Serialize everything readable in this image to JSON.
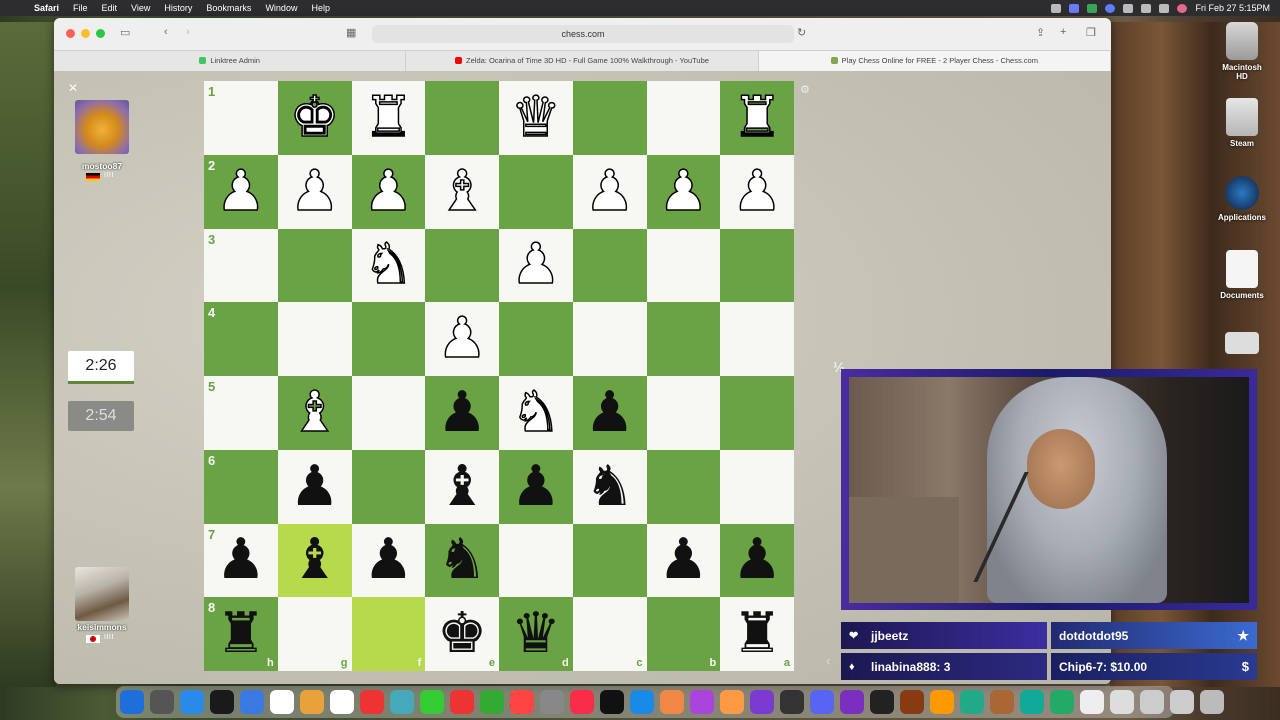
{
  "menubar": {
    "app": "Safari",
    "items": [
      "File",
      "Edit",
      "View",
      "History",
      "Bookmarks",
      "Window",
      "Help"
    ],
    "clock": "Fri Feb 27  5:15PM"
  },
  "browser": {
    "url": "chess.com",
    "tabs": [
      {
        "label": "Linktree Admin",
        "color": "#43c463"
      },
      {
        "label": "Zelda: Ocarina of Time 3D HD - Full Game 100% Walkthrough - YouTube",
        "color": "#ff0000"
      },
      {
        "label": "Play Chess Online for FREE - 2 Player Chess - Chess.com",
        "color": "#7fa650"
      }
    ]
  },
  "game": {
    "top_player": {
      "name": "mostoo87",
      "country": "de",
      "bars": "IIII"
    },
    "bottom_player": {
      "name": "keisimmons",
      "country": "jp",
      "bars": "IIII"
    },
    "clock_active": "2:26",
    "clock_inactive": "2:54",
    "draw_offer_label": "½",
    "ranks": [
      "1",
      "2",
      "3",
      "4",
      "5",
      "6",
      "7",
      "8"
    ],
    "files": [
      "h",
      "g",
      "f",
      "e",
      "d",
      "c",
      "b",
      "a"
    ],
    "board": [
      [
        "",
        "K",
        "R",
        "",
        "Q",
        "",
        "",
        "R"
      ],
      [
        "P",
        "P",
        "P",
        "B",
        "",
        "P",
        "P",
        "P"
      ],
      [
        "",
        "",
        "N",
        "",
        "P",
        "",
        "",
        ""
      ],
      [
        "",
        "",
        "",
        "P",
        "",
        "",
        "",
        ""
      ],
      [
        "",
        "B",
        "",
        "p",
        "N",
        "p",
        "",
        ""
      ],
      [
        "",
        "p",
        "",
        "b",
        "p",
        "n",
        "",
        ""
      ],
      [
        "p",
        "b",
        "p",
        "n",
        "",
        "",
        "p",
        "p"
      ],
      [
        "r",
        "",
        "",
        "k",
        "q",
        "",
        "",
        "r"
      ]
    ],
    "highlighted": [
      [
        6,
        1
      ],
      [
        7,
        2
      ]
    ]
  },
  "stream_alerts": [
    {
      "icon": "heart-icon",
      "glyph": "❤",
      "text": "jjbeetz",
      "end": ""
    },
    {
      "icon": "",
      "glyph": "",
      "text": "dotdotdot95",
      "end": "★"
    },
    {
      "icon": "diamond-icon",
      "glyph": "♦",
      "text": "linabina888: 3",
      "end": ""
    },
    {
      "icon": "",
      "glyph": "",
      "text": "Chip6-7: $10.00",
      "end": "$"
    }
  ],
  "desktop_icons": [
    {
      "label": "Macintosh HD",
      "kind": "hd"
    },
    {
      "label": "Steam",
      "kind": "stm2"
    },
    {
      "label": "Applications",
      "kind": "steam"
    },
    {
      "label": "Documents",
      "kind": "doc"
    },
    {
      "label": "",
      "kind": "scr"
    }
  ],
  "dock_colors": [
    "#1e6fd9",
    "#555",
    "#2a8ae8",
    "#1a1a1a",
    "#3a7ae0",
    "#fff",
    "#e9a23a",
    "#fff",
    "#e33",
    "#4ab",
    "#3c3",
    "#e33",
    "#3a3",
    "#f44",
    "#888",
    "#fa2d48",
    "#111",
    "#1a8ae8",
    "#e84",
    "#a4d",
    "#f94",
    "#7b3ad0",
    "#333",
    "#5865f2",
    "#7b2fbe",
    "#222",
    "#8a3a10",
    "#f90",
    "#2a8",
    "#a63",
    "#1a9",
    "#2a6",
    "#eee",
    "#ddd",
    "#ccc",
    "#ccc",
    "#bbb"
  ]
}
